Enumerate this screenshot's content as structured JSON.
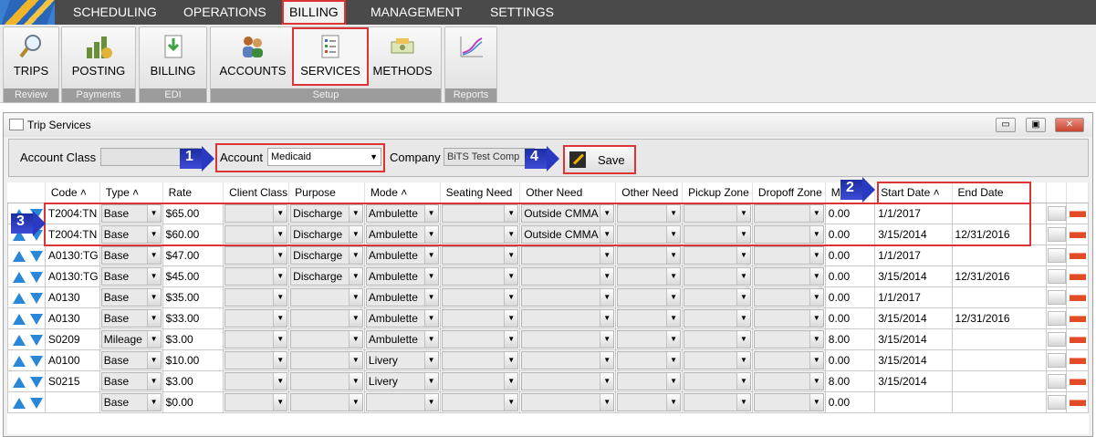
{
  "menu": {
    "items": [
      "SCHEDULING",
      "OPERATIONS",
      "BILLING",
      "MANAGEMENT",
      "SETTINGS"
    ],
    "active": "BILLING"
  },
  "ribbon": {
    "groups": [
      {
        "label": "Review",
        "buttons": [
          "TRIPS"
        ]
      },
      {
        "label": "Payments",
        "buttons": [
          "POSTING"
        ]
      },
      {
        "label": "EDI",
        "buttons": [
          "BILLING"
        ]
      },
      {
        "label": "Setup",
        "buttons": [
          "ACCOUNTS",
          "SERVICES",
          "METHODS"
        ]
      },
      {
        "label": "Reports",
        "buttons": [
          ""
        ]
      }
    ]
  },
  "window": {
    "title": "Trip Services",
    "buttons": {
      "minimize": "▭",
      "maximize": "▣",
      "close": "✕"
    }
  },
  "filters": {
    "account_class_label": "Account Class",
    "account_class_value": "",
    "account_label": "Account",
    "account_value": "Medicaid",
    "company_label": "Company",
    "company_value": "BiTS Test Comp",
    "save_label": "Save"
  },
  "callouts": [
    "1",
    "2",
    "3",
    "4"
  ],
  "grid": {
    "headers": [
      "Code",
      "Type",
      "Rate",
      "Client Class",
      "Purpose",
      "Mode",
      "Seating Need",
      "Other Need",
      "Other Need",
      "Pickup Zone",
      "Dropoff Zone",
      "M...",
      "Start Date",
      "End Date"
    ],
    "sorted_marker": "˄",
    "rows": [
      {
        "code": "T2004:TN",
        "type": "Base",
        "rate": "$65.00",
        "client_class": "",
        "purpose": "Discharge",
        "mode": "Ambulette",
        "seating": "",
        "other1": "Outside CMMA",
        "other2": "",
        "pickup": "",
        "dropoff": "",
        "m": "0.00",
        "start": "1/1/2017",
        "end": ""
      },
      {
        "code": "T2004:TN",
        "type": "Base",
        "rate": "$60.00",
        "client_class": "",
        "purpose": "Discharge",
        "mode": "Ambulette",
        "seating": "",
        "other1": "Outside CMMA",
        "other2": "",
        "pickup": "",
        "dropoff": "",
        "m": "0.00",
        "start": "3/15/2014",
        "end": "12/31/2016"
      },
      {
        "code": "A0130:TG",
        "type": "Base",
        "rate": "$47.00",
        "client_class": "",
        "purpose": "Discharge",
        "mode": "Ambulette",
        "seating": "",
        "other1": "",
        "other2": "",
        "pickup": "",
        "dropoff": "",
        "m": "0.00",
        "start": "1/1/2017",
        "end": ""
      },
      {
        "code": "A0130:TG",
        "type": "Base",
        "rate": "$45.00",
        "client_class": "",
        "purpose": "Discharge",
        "mode": "Ambulette",
        "seating": "",
        "other1": "",
        "other2": "",
        "pickup": "",
        "dropoff": "",
        "m": "0.00",
        "start": "3/15/2014",
        "end": "12/31/2016"
      },
      {
        "code": "A0130",
        "type": "Base",
        "rate": "$35.00",
        "client_class": "",
        "purpose": "",
        "mode": "Ambulette",
        "seating": "",
        "other1": "",
        "other2": "",
        "pickup": "",
        "dropoff": "",
        "m": "0.00",
        "start": "1/1/2017",
        "end": ""
      },
      {
        "code": "A0130",
        "type": "Base",
        "rate": "$33.00",
        "client_class": "",
        "purpose": "",
        "mode": "Ambulette",
        "seating": "",
        "other1": "",
        "other2": "",
        "pickup": "",
        "dropoff": "",
        "m": "0.00",
        "start": "3/15/2014",
        "end": "12/31/2016"
      },
      {
        "code": "S0209",
        "type": "Mileage",
        "rate": "$3.00",
        "client_class": "",
        "purpose": "",
        "mode": "Ambulette",
        "seating": "",
        "other1": "",
        "other2": "",
        "pickup": "",
        "dropoff": "",
        "m": "8.00",
        "start": "3/15/2014",
        "end": ""
      },
      {
        "code": "A0100",
        "type": "Base",
        "rate": "$10.00",
        "client_class": "",
        "purpose": "",
        "mode": "Livery",
        "seating": "",
        "other1": "",
        "other2": "",
        "pickup": "",
        "dropoff": "",
        "m": "0.00",
        "start": "3/15/2014",
        "end": ""
      },
      {
        "code": "S0215",
        "type": "Base",
        "rate": "$3.00",
        "client_class": "",
        "purpose": "",
        "mode": "Livery",
        "seating": "",
        "other1": "",
        "other2": "",
        "pickup": "",
        "dropoff": "",
        "m": "8.00",
        "start": "3/15/2014",
        "end": ""
      },
      {
        "code": "",
        "type": "Base",
        "rate": "$0.00",
        "client_class": "",
        "purpose": "",
        "mode": "",
        "seating": "",
        "other1": "",
        "other2": "",
        "pickup": "",
        "dropoff": "",
        "m": "0.00",
        "start": "",
        "end": ""
      }
    ]
  },
  "colors": {
    "accent_red": "#dd3333",
    "callout_blue": "#2a39c2",
    "arrow_blue": "#2a86d6",
    "delete_red": "#e14b25"
  }
}
